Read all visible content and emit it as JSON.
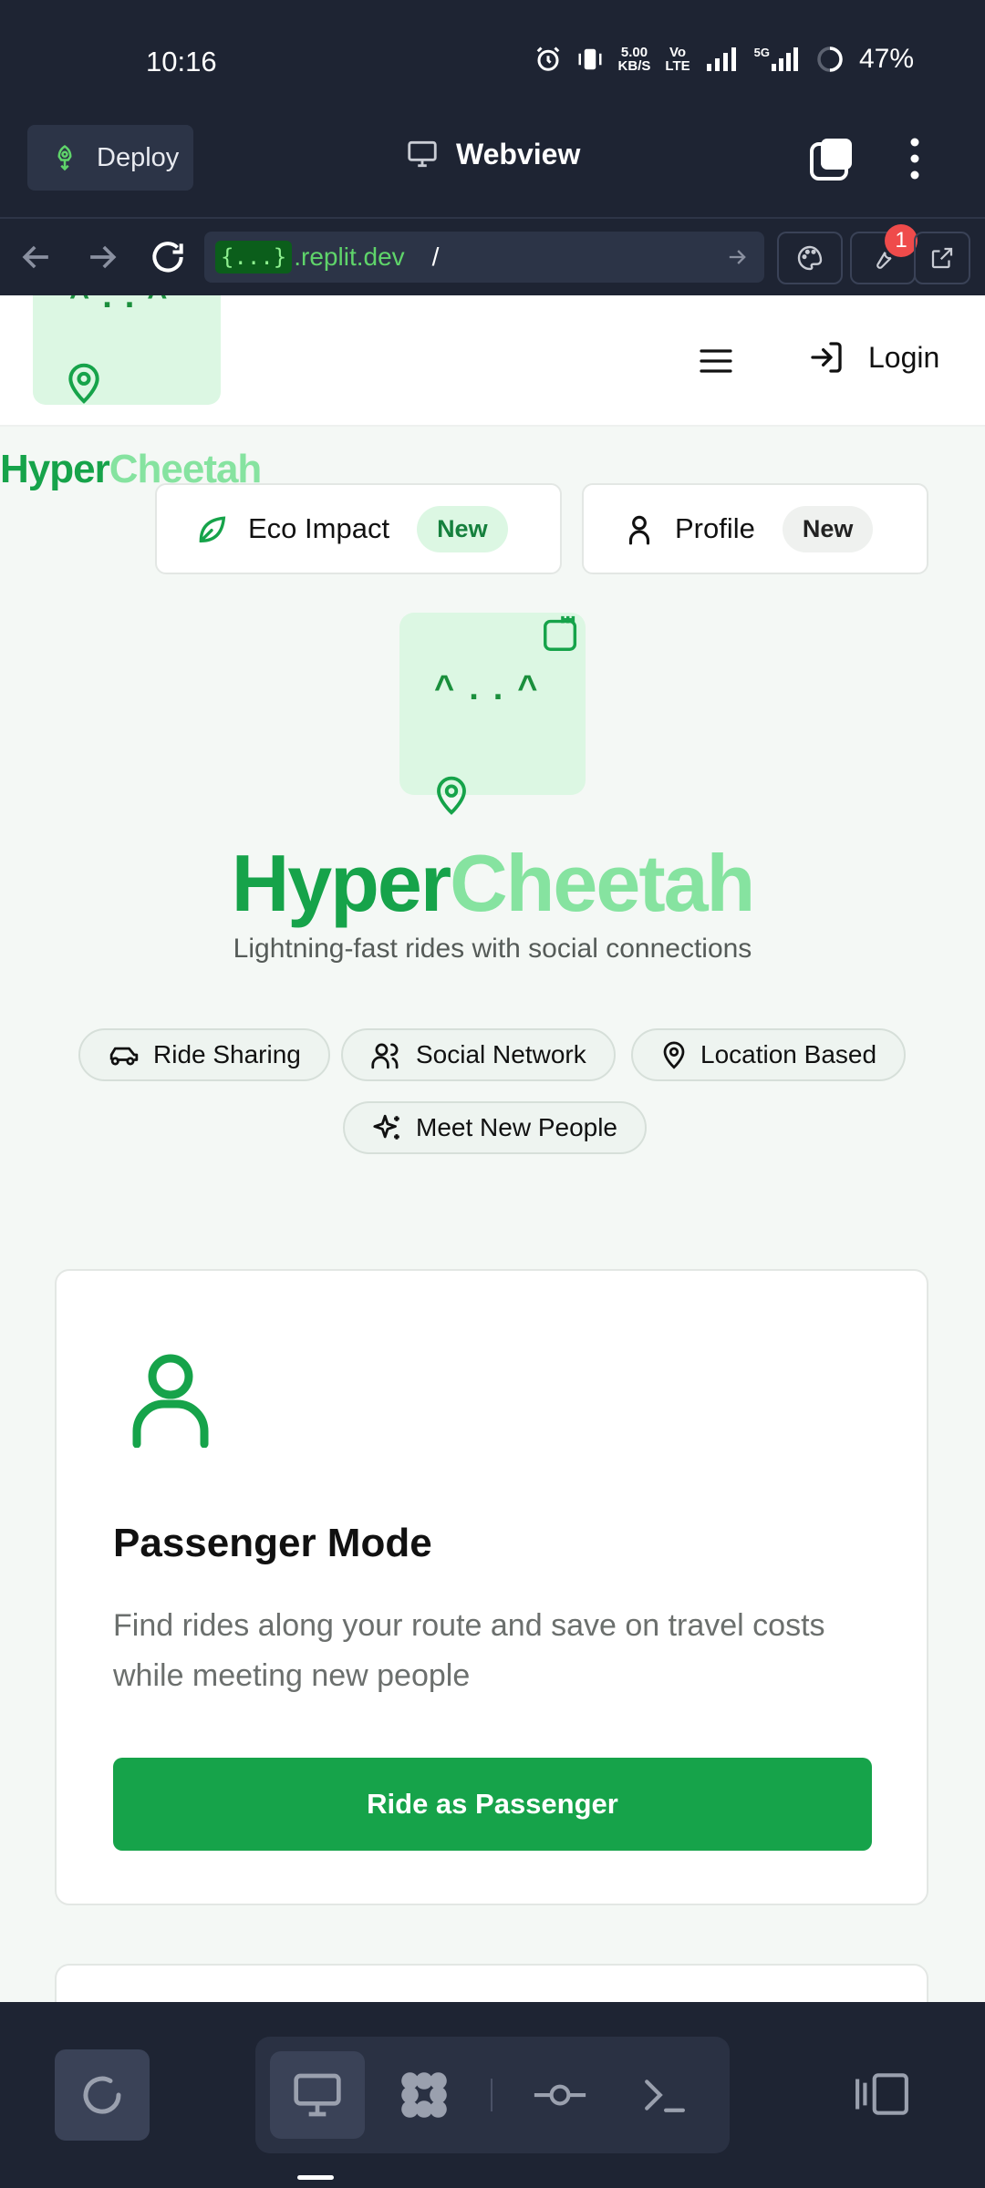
{
  "status_bar": {
    "time": "10:16",
    "net_speed_top": "5.00",
    "net_speed_bottom": "KB/S",
    "volte_top": "Vo",
    "volte_bottom": "LTE",
    "network": "5G",
    "battery": "47%"
  },
  "replit_header": {
    "deploy_label": "Deploy",
    "title": "Webview"
  },
  "url_bar": {
    "tag": "{...}",
    "host": ".replit.dev",
    "path": "/",
    "notification_count": "1"
  },
  "site": {
    "logo_face": "^..^",
    "brand_hyper": "Hyper",
    "brand_cheetah": "Cheetah",
    "login_label": "Login",
    "pills": [
      {
        "label": "Eco Impact",
        "badge": "New"
      },
      {
        "label": "Profile",
        "badge": "New"
      }
    ],
    "hero": {
      "title_hyper": "Hyper",
      "title_cheetah": "Cheetah",
      "subtitle": "Lightning-fast rides with social connections"
    },
    "chips": [
      "Ride Sharing",
      "Social Network",
      "Location Based",
      "Meet New People"
    ],
    "passenger_card": {
      "title": "Passenger Mode",
      "description": "Find rides along your route and save on travel costs while meeting new people",
      "button": "Ride as Passenger"
    }
  },
  "colors": {
    "primary_green": "#16a34a",
    "light_green": "#86e3a0",
    "mint_bg": "#dcf7e3",
    "dark_ui": "#1e2433"
  }
}
